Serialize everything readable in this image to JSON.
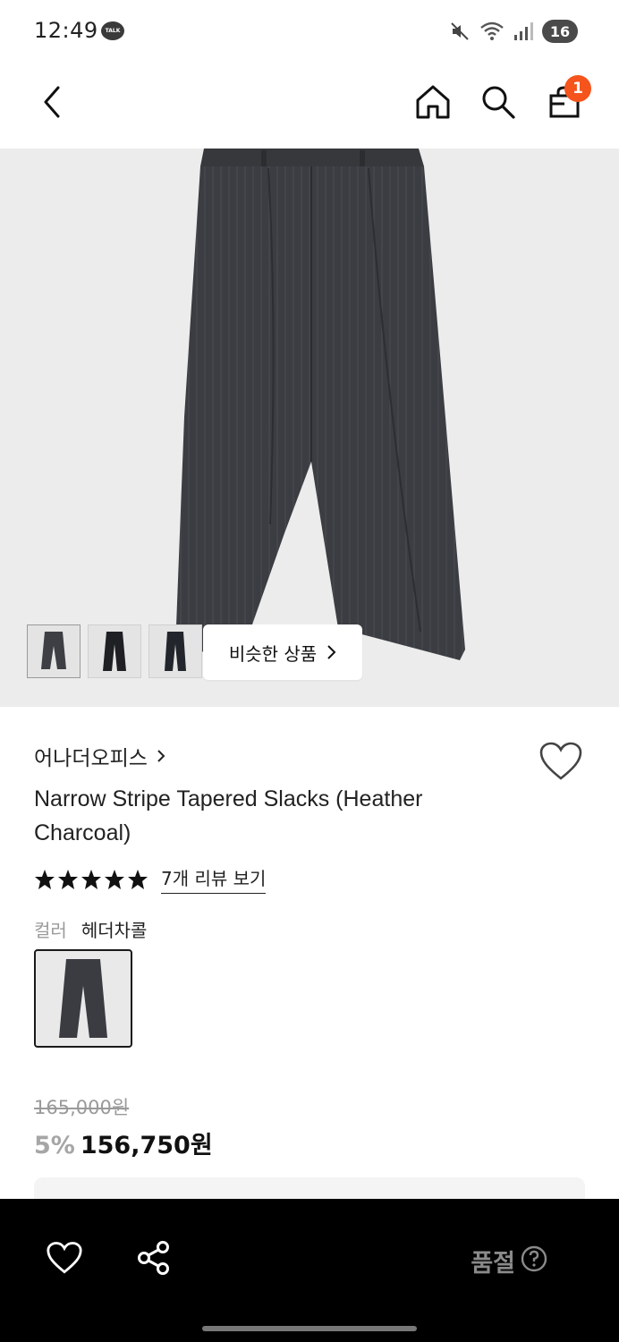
{
  "status_bar": {
    "time": "12:49",
    "talk_badge": "TALK",
    "battery": "16"
  },
  "header": {
    "back_icon": "chevron-left-icon",
    "home_icon": "home-icon",
    "search_icon": "search-icon",
    "cart_icon": "shopping-bag-icon",
    "cart_count": "1",
    "badge_color": "#f5541c"
  },
  "gallery": {
    "thumbnail_count": 3,
    "similar_button_label": "비슷한 상품",
    "similar_chevron": "›"
  },
  "product": {
    "brand": "어나더오피스",
    "brand_chevron": "›",
    "title": "Narrow Stripe Tapered Slacks (Heather Charcoal)",
    "rating_stars": 5,
    "review_link": "7개 리뷰 보기",
    "color_label": "컬러",
    "color_value": "헤더차콜",
    "original_price": "165,000원",
    "discount": "5%",
    "sale_price": "156,750원"
  },
  "bottom_bar": {
    "wishlist_icon": "heart-icon",
    "share_icon": "share-icon",
    "status_label": "품절",
    "help_icon": "question-circle-icon"
  }
}
